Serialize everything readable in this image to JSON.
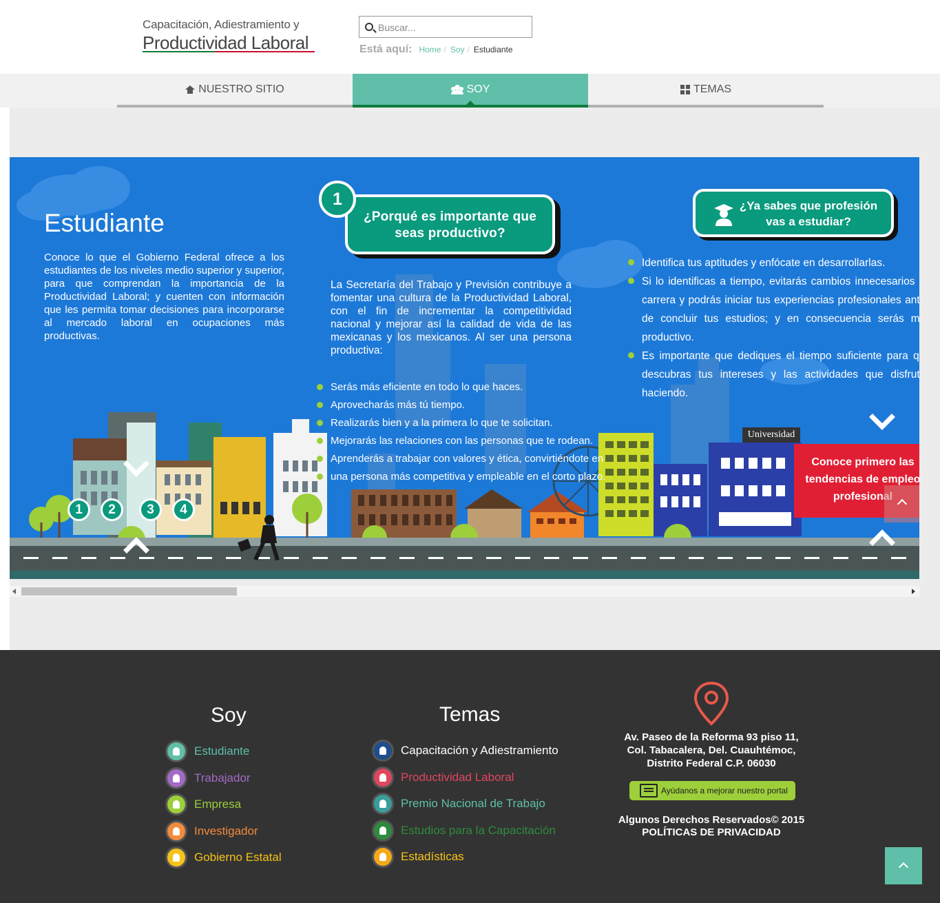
{
  "header": {
    "logo_top": "Capacitación, Adiestramiento y",
    "logo_main": "Productividad Laboral",
    "search_placeholder": "Buscar...",
    "breadcrumb_label": "Está aquí:",
    "breadcrumb": [
      "Home",
      "Soy",
      "Estudiante"
    ]
  },
  "nav": {
    "items": [
      "NUESTRO SITIO",
      "SOY",
      "TEMAS"
    ],
    "active": "SOY"
  },
  "banner": {
    "title": "Estudiante",
    "intro": "Conoce lo que el Gobierno Federal ofrece a los estudiantes de los niveles medio superior y superior, para que comprendan la importancia de la Productividad Laboral; y cuenten con información que les permita tomar decisiones para incorporarse al mercado laboral en ocupaciones más productivas.",
    "box1_number": "1",
    "box1_title": "¿Porqué es importante que seas productivo?",
    "mid_text": "La Secretaría del Trabajo y Previsión contribuye a fomentar una cultura de la Productividad Laboral, con el fin de incrementar la competitividad nacional y mejorar así la calidad de vida de las mexicanas y los mexicanos. Al ser una persona productiva:",
    "mid_bullets": [
      "Serás más eficiente en todo lo que haces.",
      "Aprovecharás más tú tiempo.",
      "Realizarás bien y a la primera lo que te solicitan.",
      "Mejorarás las relaciones con las personas que te rodean.",
      "Aprenderás a trabajar con valores y ética, convirtiéndote en",
      "una persona más competitiva y empleable en el corto plazo."
    ],
    "box2_title": "¿Ya sabes que profesión vas a estudiar?",
    "right_bullets": [
      "Identifica tus aptitudes y enfócate en desarrollarlas.",
      "Si lo identificas a tiempo, evitarás cambios innecesarios de carrera y podrás iniciar tus experiencias profesionales antes de concluir tus estudios; y en consecuencia serás más productivo.",
      "Es importante que dediques el tiempo suficiente para que descubras tus intereses y las actividades que disfrutas haciendo."
    ],
    "university_label": "Universidad",
    "red_box": [
      "Conoce primero las",
      "tendencias de empleo",
      "profesional"
    ],
    "steps": [
      "1",
      "2",
      "3",
      "4"
    ]
  },
  "footer": {
    "soy_title": "Soy",
    "soy_items": [
      {
        "label": "Estudiante",
        "color": "#5fbfa9",
        "icon": "student-icon"
      },
      {
        "label": "Trabajador",
        "color": "#a36ac7",
        "icon": "worker-icon"
      },
      {
        "label": "Empresa",
        "color": "#9ccf3a",
        "icon": "building-icon"
      },
      {
        "label": "Investigador",
        "color": "#f38b3c",
        "icon": "researcher-icon"
      },
      {
        "label": "Gobierno Estatal",
        "color": "#f5c218",
        "icon": "government-icon"
      }
    ],
    "temas_title": "Temas",
    "temas_items": [
      {
        "label": "Capacitación y Adiestramiento",
        "color": "#ffffff",
        "icon_color": "#1f4e8c",
        "icon": "training-icon"
      },
      {
        "label": "Productividad Laboral",
        "color": "#e0465f",
        "icon_color": "#e0465f",
        "icon": "productivity-icon"
      },
      {
        "label": "Premio Nacional de Trabajo",
        "color": "#5fbfa9",
        "icon_color": "#3a9e9a",
        "icon": "award-icon"
      },
      {
        "label": "Estudios para la Capacitación",
        "color": "#2e8b3d",
        "icon_color": "#2e8b3d",
        "icon": "studies-icon"
      },
      {
        "label": "Estadísticas",
        "color": "#f5c218",
        "icon_color": "#f5a818",
        "icon": "stats-icon"
      }
    ],
    "address": [
      "Av. Paseo de la Reforma 93 piso 11,",
      "Col. Tabacalera, Del. Cuauhtémoc,",
      "Distrito Federal C.P. 06030"
    ],
    "feedback_label": "Ayúdanos a mejorar nuestro portal",
    "rights": "Algunos Derechos Reservados© 2015",
    "privacy": "POLÍTICAS DE PRIVACIDAD"
  }
}
